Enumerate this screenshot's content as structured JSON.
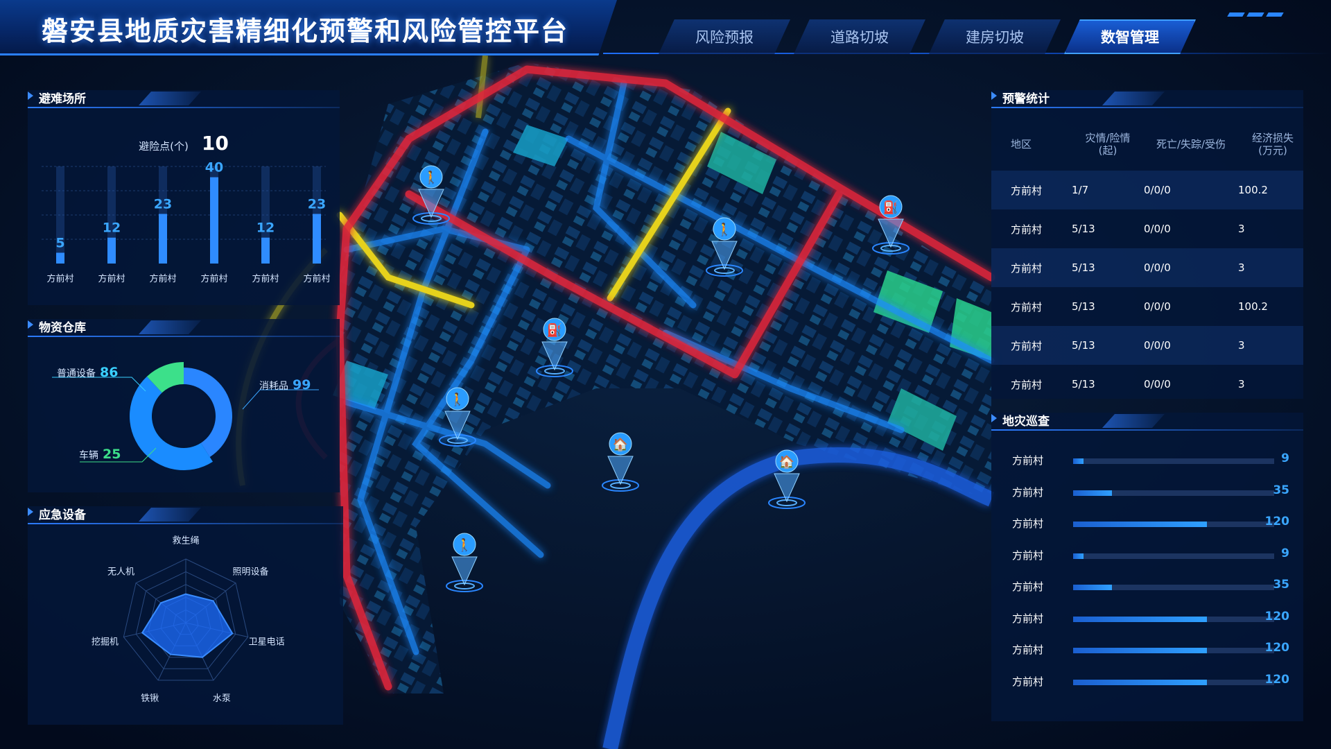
{
  "header": {
    "title": "磐安县地质灾害精细化预警和风险管控平台",
    "tabs": [
      {
        "label": "风险预报",
        "active": false
      },
      {
        "label": "道路切坡",
        "active": false
      },
      {
        "label": "建房切坡",
        "active": false
      },
      {
        "label": "数智管理",
        "active": true
      }
    ]
  },
  "shelter": {
    "title": "避难场所",
    "count_label": "避险点(个)",
    "count_value": "10"
  },
  "warehouse": {
    "title": "物资仓库",
    "items": [
      {
        "label": "普通设备",
        "value": 86,
        "color": "#2a86ff"
      },
      {
        "label": "消耗品",
        "value": 99,
        "color": "#1a8cff"
      },
      {
        "label": "车辆",
        "value": 25,
        "color": "#3ce08a"
      }
    ]
  },
  "emergency": {
    "title": "应急设备"
  },
  "warning": {
    "title": "预警统计",
    "columns": [
      "地区",
      "灾情/险情\n(起)",
      "死亡/失踪/受伤",
      "经济损失\n(万元)"
    ],
    "rows": [
      [
        "方前村",
        "1/7",
        "0/0/0",
        "100.2"
      ],
      [
        "方前村",
        "5/13",
        "0/0/0",
        "3"
      ],
      [
        "方前村",
        "5/13",
        "0/0/0",
        "3"
      ],
      [
        "方前村",
        "5/13",
        "0/0/0",
        "100.2"
      ],
      [
        "方前村",
        "5/13",
        "0/0/0",
        "3"
      ],
      [
        "方前村",
        "5/13",
        "0/0/0",
        "3"
      ]
    ]
  },
  "patrol": {
    "title": "地灾巡查",
    "max": 180,
    "rows": [
      {
        "name": "方前村",
        "value": 9
      },
      {
        "name": "方前村",
        "value": 35
      },
      {
        "name": "方前村",
        "value": 120
      },
      {
        "name": "方前村",
        "value": 9
      },
      {
        "name": "方前村",
        "value": 35
      },
      {
        "name": "方前村",
        "value": 120
      },
      {
        "name": "方前村",
        "value": 120
      },
      {
        "name": "方前村",
        "value": 120
      }
    ]
  },
  "chart_data": [
    {
      "type": "bar",
      "categories": [
        "方前村",
        "方前村",
        "方前村",
        "方前村",
        "方前村",
        "方前村"
      ],
      "values": [
        5,
        12,
        23,
        40,
        12,
        23
      ],
      "ylim": [
        0,
        45
      ]
    },
    {
      "type": "pie",
      "labels": [
        "普通设备",
        "消耗品",
        "车辆"
      ],
      "values": [
        86,
        99,
        25
      ]
    },
    {
      "type": "radar",
      "axes": [
        "救生绳",
        "照明设备",
        "卫星电话",
        "水泵",
        "铁锹",
        "挖掘机",
        "无人机"
      ],
      "values": [
        0.45,
        0.55,
        0.75,
        0.6,
        0.55,
        0.7,
        0.5
      ]
    }
  ],
  "colors": {
    "accent": "#2a86ff",
    "bar": "#2f8cff",
    "value_label": "#3aa6ff",
    "panel_bg": "#041638",
    "road_red": "#e0263a",
    "road_yellow": "#e6d21a",
    "road_blue": "#1f8bff"
  },
  "map_pins": [
    {
      "icon": "walker-icon"
    },
    {
      "icon": "walker-icon"
    },
    {
      "icon": "walker-icon"
    },
    {
      "icon": "walker-icon"
    },
    {
      "icon": "fuel-icon"
    },
    {
      "icon": "fuel-icon"
    },
    {
      "icon": "building-icon"
    },
    {
      "icon": "building-icon"
    }
  ]
}
